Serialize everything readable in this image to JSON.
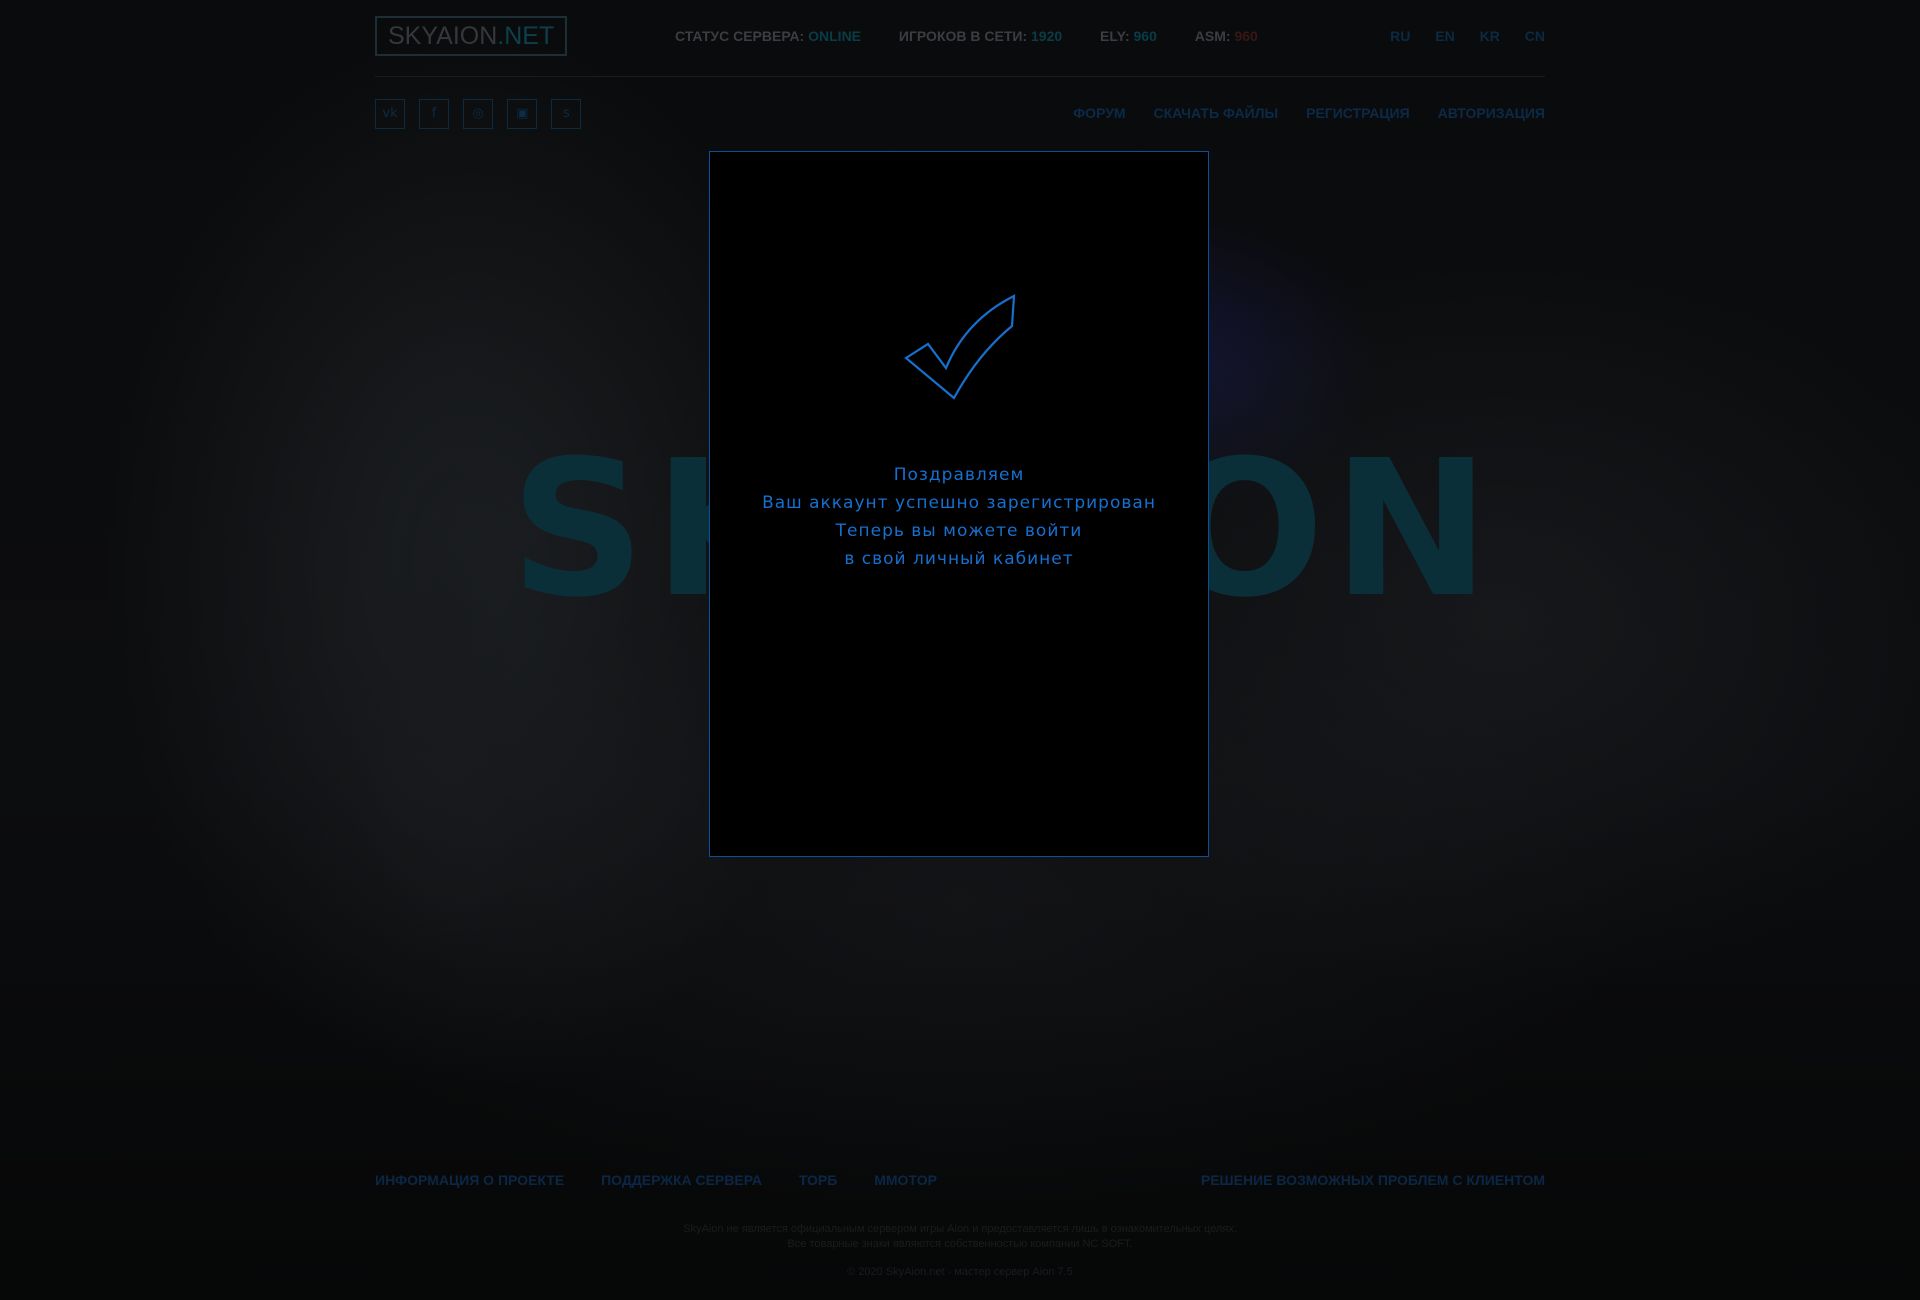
{
  "header": {
    "logo": {
      "main": "SKYAION",
      "suffix": ".NET"
    },
    "stats": [
      {
        "label": "СТАТУС СЕРВЕРА:",
        "value": "ONLINE"
      },
      {
        "label": "ИГРОКОВ В СЕТИ:",
        "value": "1920"
      },
      {
        "label": "ELY:",
        "value": "960"
      },
      {
        "label": "ASM:",
        "value": "960"
      }
    ],
    "languages": [
      "RU",
      "EN",
      "KR",
      "CN"
    ]
  },
  "socials": [
    {
      "icon": "vk-icon",
      "glyph": "vk"
    },
    {
      "icon": "facebook-icon",
      "glyph": "f"
    },
    {
      "icon": "instagram-icon",
      "glyph": "◎"
    },
    {
      "icon": "chat-icon",
      "glyph": "▣"
    },
    {
      "icon": "skype-icon",
      "glyph": "s"
    }
  ],
  "nav": [
    "ФОРУМ",
    "СКАЧАТЬ ФАЙЛЫ",
    "РЕГИСТРАЦИЯ",
    "АВТОРИЗАЦИЯ"
  ],
  "background": {
    "logo_text": "SKYAION"
  },
  "modal": {
    "icon": "checkmark-icon",
    "lines": [
      "Поздравляем",
      "Ваш аккаунт успешно зарегистрирован",
      "Теперь вы можете войти",
      "в свой личный кабинет"
    ],
    "accent_color": "#1770cf"
  },
  "footer": {
    "links": [
      "ИНФОРМАЦИЯ О ПРОЕКТЕ",
      "ПОДДЕРЖКА СЕРВЕРА",
      "ТОРБ",
      "MMOTOP"
    ],
    "right_link": "РЕШЕНИЕ ВОЗМОЖНЫХ ПРОБЛЕМ С КЛИЕНТОМ",
    "disclaimer_1": "SkyAion не является официальным сервером игры Aion и предоставляется лишь в ознакомительных целях.",
    "disclaimer_2": "Все товарные знаки являются собственностью компании NC SOFT.",
    "copyright": "© 2020 SkyAion.net - мастер сервер Aion 7.5"
  }
}
